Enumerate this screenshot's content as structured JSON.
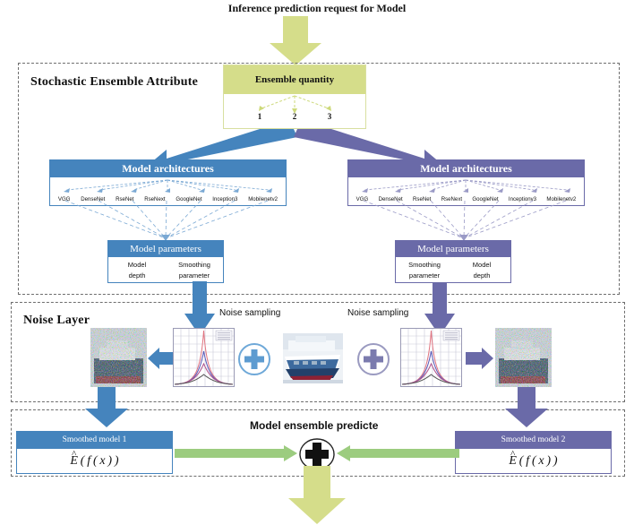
{
  "diagram": {
    "top_heading": "Inference prediction request for Model",
    "sections": [
      {
        "title": "Stochastic Ensemble Attribute"
      },
      {
        "title": "Noise Layer"
      }
    ],
    "ensemble": {
      "header": "Ensemble quantity",
      "options": [
        "1",
        "2",
        "3"
      ],
      "selected": "2"
    },
    "branch_left": {
      "architectures_header": "Model architectures",
      "architectures": [
        "VGG",
        "DenseNet",
        "RseNet",
        "RseNext",
        "GoogleNet",
        "Inception3",
        "Mobilenetv2"
      ],
      "parameters_header": "Model parameters",
      "parameters": [
        "Model depth",
        "Smoothing parameter"
      ],
      "parameter_line1": [
        "Model",
        "Smoothing"
      ],
      "parameter_line2": [
        "depth",
        "parameter"
      ],
      "noise_sampling_label": "Noise sampling",
      "smoothed_model_label": "Smoothed model 1",
      "smoothed_model_formula": "E(f(x))",
      "color": "#4584bd"
    },
    "branch_right": {
      "architectures_header": "Model architectures",
      "architectures": [
        "VGG",
        "DenseNet",
        "RseNet",
        "RseNext",
        "GoogleNet",
        "Inceptionv3",
        "Mobilenetv2"
      ],
      "parameters_header": "Model parameters",
      "parameters": [
        "Smoothing parameter",
        "Model depth"
      ],
      "parameter_line1": [
        "Smoothing",
        "Model"
      ],
      "parameter_line2": [
        "parameter",
        "depth"
      ],
      "noise_sampling_label": "Noise sampling",
      "smoothed_model_label": "Smoothed model 2",
      "smoothed_model_formula": "E(f(x))",
      "color": "#6a6aa8"
    },
    "ensemble_predict_label": "Model ensemble predicte",
    "icons": {
      "plus_left": "plus-circle-icon",
      "plus_right": "plus-circle-icon",
      "plus_sum": "plus-sum-icon",
      "noise_plot_left": "noise-distribution-plot",
      "noise_plot_right": "noise-distribution-plot",
      "clean_image": "ship-photo",
      "noisy_image_left": "noisy-ship-photo",
      "noisy_image_right": "noisy-ship-photo"
    },
    "colors": {
      "olive": "#d5dd8a",
      "blue": "#4584bd",
      "purple": "#6a6aa8",
      "green_arrow": "#9ccc7f",
      "dashed_border": "#6e6e6e"
    }
  }
}
